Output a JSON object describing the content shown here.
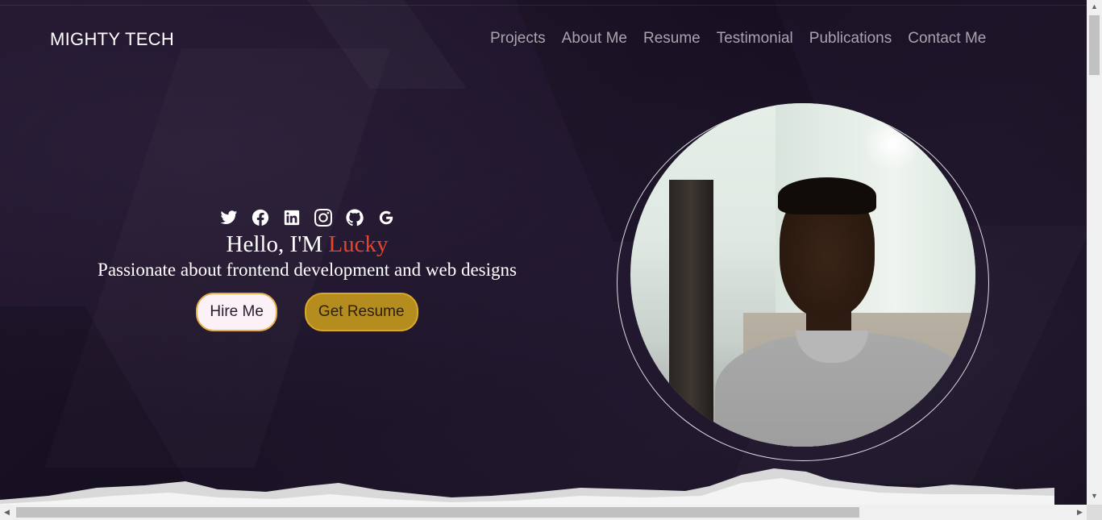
{
  "header": {
    "brand": "MIGHTY TECH",
    "nav": [
      "Projects",
      "About Me",
      "Resume",
      "Testimonial",
      "Publications",
      "Contact Me"
    ]
  },
  "hero": {
    "socials": [
      "twitter-icon",
      "facebook-icon",
      "linkedin-icon",
      "instagram-icon",
      "github-icon",
      "google-icon"
    ],
    "greeting": "Hello, I'M",
    "name": "Lucky",
    "tagline": "Passionate about frontend development and web designs",
    "hire_label": "Hire Me",
    "resume_label": "Get Resume"
  },
  "colors": {
    "background": "#1b1125",
    "accent_name": "#e8442a",
    "resume_button": "#b58d1f",
    "hire_button": "#fbf1f7"
  }
}
